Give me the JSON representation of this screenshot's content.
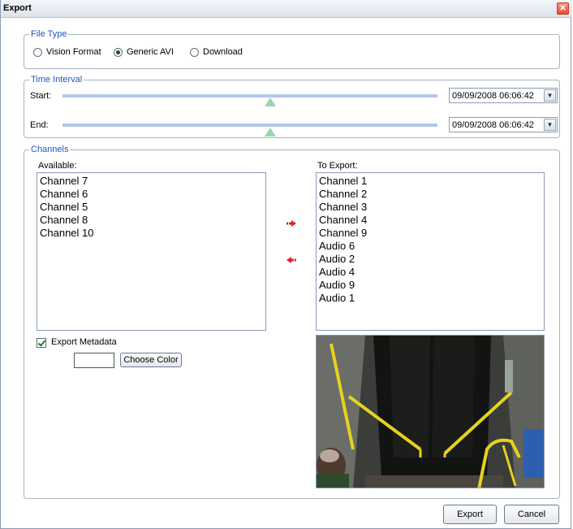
{
  "window": {
    "title": "Export",
    "close_glyph": "✕"
  },
  "file_type": {
    "legend": "File Type",
    "options": [
      {
        "label": "Vision Format",
        "selected": false
      },
      {
        "label": "Generic AVI",
        "selected": true
      },
      {
        "label": "Download",
        "selected": false
      }
    ]
  },
  "time_interval": {
    "legend": "Time Interval",
    "start_label": "Start:",
    "end_label": "End:",
    "start_value": "09/09/2008 06:06:42",
    "end_value": "09/09/2008 06:06:42",
    "dropdown_glyph": "▼"
  },
  "channels": {
    "legend": "Channels",
    "available_label": "Available:",
    "to_export_label": "To Export:",
    "available": [
      "Channel 7",
      "Channel 6",
      "Channel 5",
      "Channel 8",
      "Channel 10"
    ],
    "to_export": [
      "Channel 1",
      "Channel 2",
      "Channel 3",
      "Channel 4",
      "Channel 9",
      "Audio 6",
      "Audio 2",
      "Audio 4",
      "Audio 9",
      "Audio 1"
    ],
    "export_metadata_label": "Export Metadata",
    "export_metadata_checked": true,
    "choose_color_label": "Choose Color"
  },
  "buttons": {
    "export": "Export",
    "cancel": "Cancel"
  },
  "colors": {
    "legend_text": "#2255c5",
    "slider_track": "#b3c6ea",
    "slider_thumb": "#9fd3b0",
    "arrow": "#e02020"
  }
}
